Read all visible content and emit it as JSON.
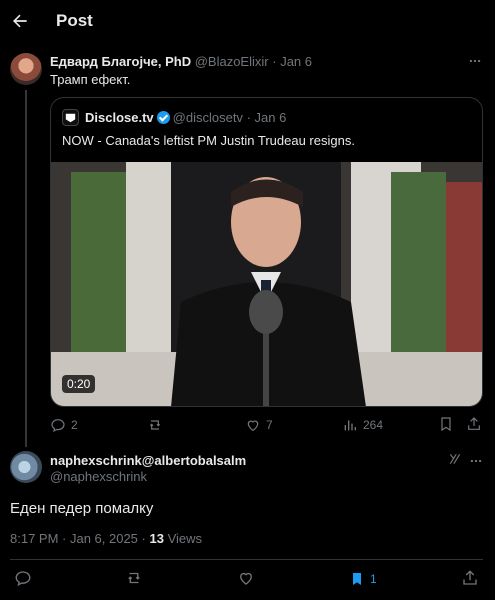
{
  "header": {
    "title": "Post"
  },
  "post": {
    "author_name": "Едвард Благојче, PhD",
    "author_handle": "@BlazoElixir",
    "separator": "·",
    "date": "Jan 6",
    "text": "Трамп ефект."
  },
  "quote": {
    "author_name": "Disclose.tv",
    "author_handle": "@disclosetv",
    "separator": "·",
    "date": "Jan 6",
    "text": "NOW - Canada's leftist PM Justin Trudeau resigns.",
    "video_duration": "0:20"
  },
  "post_actions": {
    "replies": "2",
    "reposts": "",
    "likes": "7",
    "views": "264"
  },
  "reply": {
    "author_name": "naphexschrink@albertobalsalm",
    "author_handle": "@naphexschrink",
    "text": "Еден педер помалку",
    "timestamp": "8:17 PM · Jan 6, 2025",
    "separator": " · ",
    "views_count": "13",
    "views_label": " Views"
  },
  "reply_actions": {
    "bookmarks": "1"
  },
  "colors": {
    "accent": "#1d9bf0",
    "muted": "#71767b",
    "background": "#000000",
    "text": "#e7e9ea"
  }
}
